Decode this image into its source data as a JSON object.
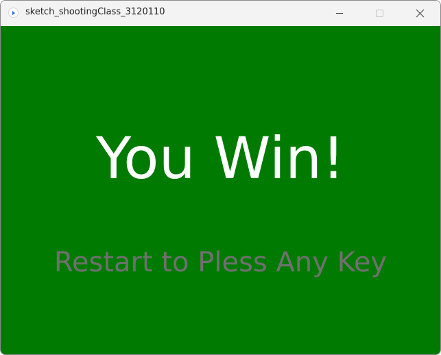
{
  "window": {
    "title": "sketch_shootingClass_3120110",
    "app_icon": "processing-play-icon",
    "controls": {
      "minimize_icon": "minimize-icon",
      "maximize_icon": "maximize-icon",
      "close_icon": "close-icon"
    }
  },
  "game": {
    "background_color": "#007a00",
    "headline": "You Win!",
    "headline_color": "#ffffff",
    "prompt": "Restart to Pless Any Key",
    "prompt_color": "#707070"
  }
}
